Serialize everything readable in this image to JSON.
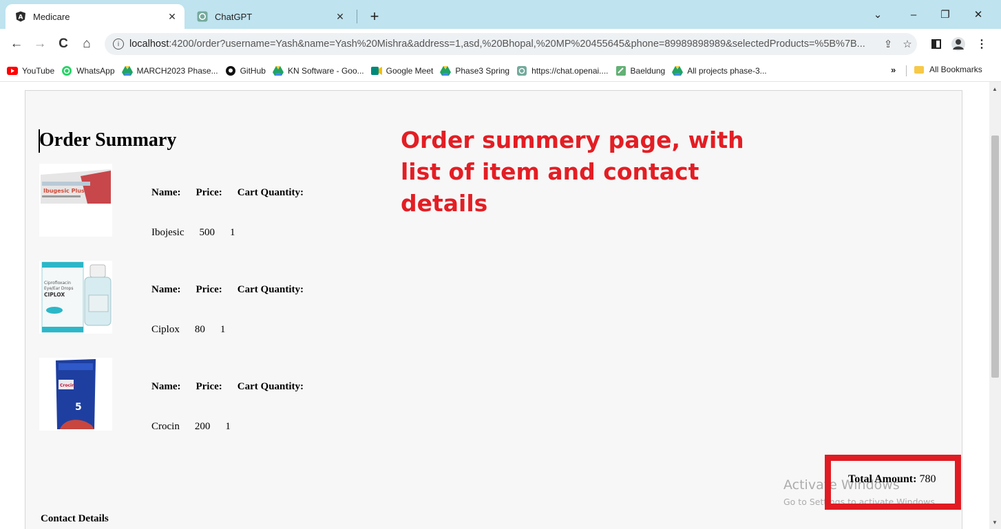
{
  "browser": {
    "tabs": [
      {
        "title": "Medicare",
        "icon": "angular-icon",
        "active": true
      },
      {
        "title": "ChatGPT",
        "icon": "chatgpt-icon",
        "active": false
      }
    ],
    "new_tab": "+",
    "window_controls": {
      "dropdown": "⌄",
      "minimize": "–",
      "restore": "❐",
      "close": "✕"
    },
    "nav": {
      "back": "←",
      "forward": "→",
      "reload": "C",
      "home": "⌂"
    },
    "url_host": "localhost",
    "url_rest": ":4200/order?username=Yash&name=Yash%20Mishra&address=1,asd,%20Bhopal,%20MP%20455645&phone=89989898989&selectedProducts=%5B%7B...",
    "bookmarks": [
      {
        "label": "YouTube",
        "icon": "youtube-icon",
        "color": "#ff0000"
      },
      {
        "label": "WhatsApp",
        "icon": "whatsapp-icon",
        "color": "#25d366"
      },
      {
        "label": "MARCH2023 Phase...",
        "icon": "google-drive-icon",
        "color": "#1fa463"
      },
      {
        "label": "GitHub",
        "icon": "github-icon",
        "color": "#000000"
      },
      {
        "label": "KN Software - Goo...",
        "icon": "google-drive-icon",
        "color": "#1fa463"
      },
      {
        "label": "Google Meet",
        "icon": "google-meet-icon",
        "color": "#00897b"
      },
      {
        "label": "Phase3 Spring",
        "icon": "google-drive-icon",
        "color": "#1fa463"
      },
      {
        "label": "https://chat.openai....",
        "icon": "chatgpt-icon",
        "color": "#74aa9c"
      },
      {
        "label": "Baeldung",
        "icon": "baeldung-icon",
        "color": "#63b175"
      },
      {
        "label": "All projects phase-3...",
        "icon": "google-drive-icon",
        "color": "#1fa463"
      }
    ],
    "bookmarks_more": "»",
    "all_bookmarks": "All Bookmarks"
  },
  "page": {
    "title": "Order Summary",
    "labels": {
      "name": "Name:",
      "price": "Price:",
      "quantity": "Cart Quantity:"
    },
    "products": [
      {
        "name": "Ibojesic",
        "price": "500",
        "quantity": "1",
        "image": "ibugesic-plus-box"
      },
      {
        "name": "Ciplox",
        "price": "80",
        "quantity": "1",
        "image": "ciplox-eye-drops-box"
      },
      {
        "name": "Crocin",
        "price": "200",
        "quantity": "1",
        "image": "crocin-tablets-box"
      }
    ],
    "total_label": "Total Amount:",
    "total_value": "780",
    "contact_heading": "Contact Details"
  },
  "annotation": {
    "text": "Order summery page, with list of item and contact details",
    "color": "#e31e24"
  },
  "watermark": {
    "line1": "Activate Windows",
    "line2": "Go to Settings to activate Windows."
  }
}
